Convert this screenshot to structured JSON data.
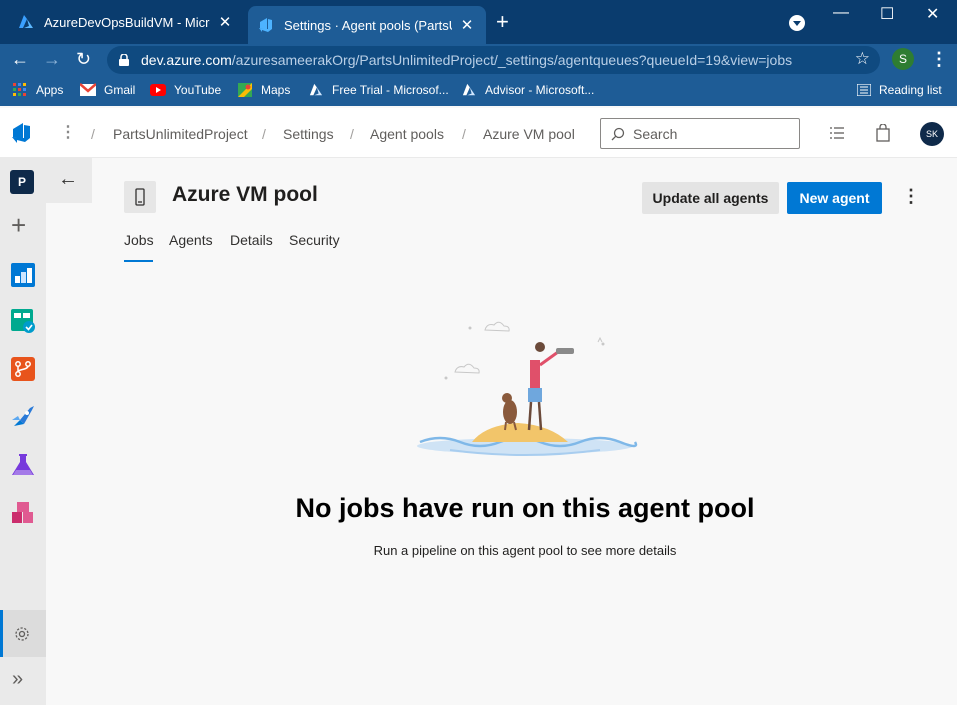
{
  "browser": {
    "tabs": [
      {
        "title": "AzureDevOpsBuildVM - Microsof",
        "active": false
      },
      {
        "title": "Settings · Agent pools (PartsUnlim",
        "active": true
      }
    ],
    "url_host": "dev.azure.com",
    "url_path": "/azuresameerakOrg/PartsUnlimitedProject/_settings/agentqueues?queueId=19&view=jobs",
    "profile_initial": "S",
    "bookmarks": [
      {
        "label": "Apps",
        "icon": "apps-grid-icon"
      },
      {
        "label": "Gmail",
        "icon": "gmail-icon"
      },
      {
        "label": "YouTube",
        "icon": "youtube-icon"
      },
      {
        "label": "Maps",
        "icon": "maps-icon"
      },
      {
        "label": "Free Trial - Microsof...",
        "icon": "azure-icon"
      },
      {
        "label": "Advisor - Microsoft...",
        "icon": "azure-icon"
      }
    ],
    "reading_list": "Reading list"
  },
  "header": {
    "breadcrumbs": [
      "PartsUnlimitedProject",
      "Settings",
      "Agent pools",
      "Azure VM pool"
    ],
    "search_placeholder": "Search",
    "user_initials": "SK"
  },
  "page": {
    "title": "Azure VM pool",
    "update_button": "Update all agents",
    "new_button": "New agent",
    "tabs": [
      "Jobs",
      "Agents",
      "Details",
      "Security"
    ],
    "active_tab": "Jobs",
    "empty_title": "No jobs have run on this agent pool",
    "empty_subtitle": "Run a pipeline on this agent pool to see more details"
  },
  "nav": {
    "project_initial": "P"
  },
  "colors": {
    "accent": "#0078d4",
    "tabbar": "#0a3c6e",
    "toolbar": "#1e5c96"
  }
}
